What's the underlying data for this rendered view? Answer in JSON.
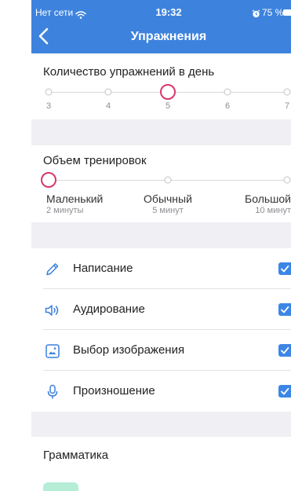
{
  "status_bar": {
    "carrier": "Нет сети",
    "time": "19:32",
    "battery": "75 %",
    "icons": [
      "wifi-icon",
      "alarm-icon",
      "battery-icon"
    ]
  },
  "nav": {
    "back_icon": "chevron-left-icon",
    "title": "Упражнения"
  },
  "daily_count": {
    "title": "Количество упражнений в день",
    "options": [
      "3",
      "4",
      "5",
      "6",
      "7"
    ],
    "selected": "5"
  },
  "volume": {
    "title": "Объем тренировок",
    "options": [
      {
        "label": "Маленький",
        "duration": "2 минуты"
      },
      {
        "label": "Обычный",
        "duration": "5 минут"
      },
      {
        "label": "Большой",
        "duration": "10 минут"
      }
    ],
    "selected": "Маленький"
  },
  "exercises": [
    {
      "label": "Написание",
      "icon": "pencil-icon",
      "checked": true
    },
    {
      "label": "Аудирование",
      "icon": "speaker-icon",
      "checked": true
    },
    {
      "label": "Выбор изображения",
      "icon": "image-icon",
      "checked": true
    },
    {
      "label": "Произношение",
      "icon": "microphone-icon",
      "checked": true
    }
  ],
  "grammar": {
    "title": "Грамматика"
  },
  "colors": {
    "header": "#3d83de",
    "accent": "#3a7fdf",
    "checkbox": "#3d86e6",
    "selected_ring": "#d6386a",
    "group_separator": "#efeff4"
  }
}
